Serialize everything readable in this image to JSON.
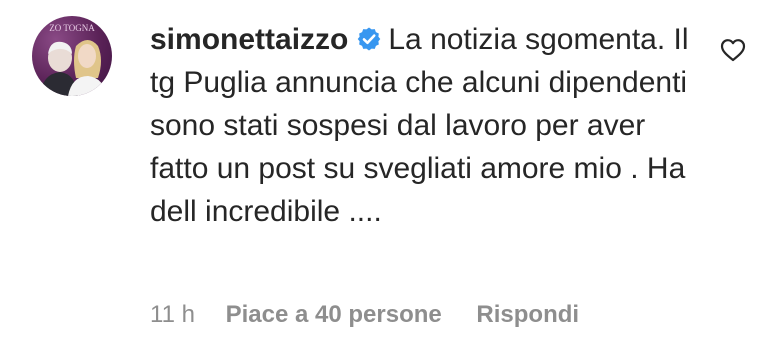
{
  "comment": {
    "username": "simonettaizzo",
    "verified": true,
    "text": "La notizia sgomenta. Il tg Puglia annuncia che alcuni dipendenti sono stati sospesi dal lavoro per aver fatto un post su svegliati amore mio . Ha dell incredibile ....",
    "time": "11 h",
    "likes_label": "Piace a 40 persone",
    "reply_label": "Rispondi",
    "avatar_text": "ZO TOGNA"
  },
  "colors": {
    "text": "#262626",
    "meta": "#8e8e8e",
    "verified": "#3897f0",
    "avatar_bg": "#5a2257"
  },
  "icons": {
    "verified": "verified-badge-icon",
    "like": "heart-outline-icon"
  }
}
